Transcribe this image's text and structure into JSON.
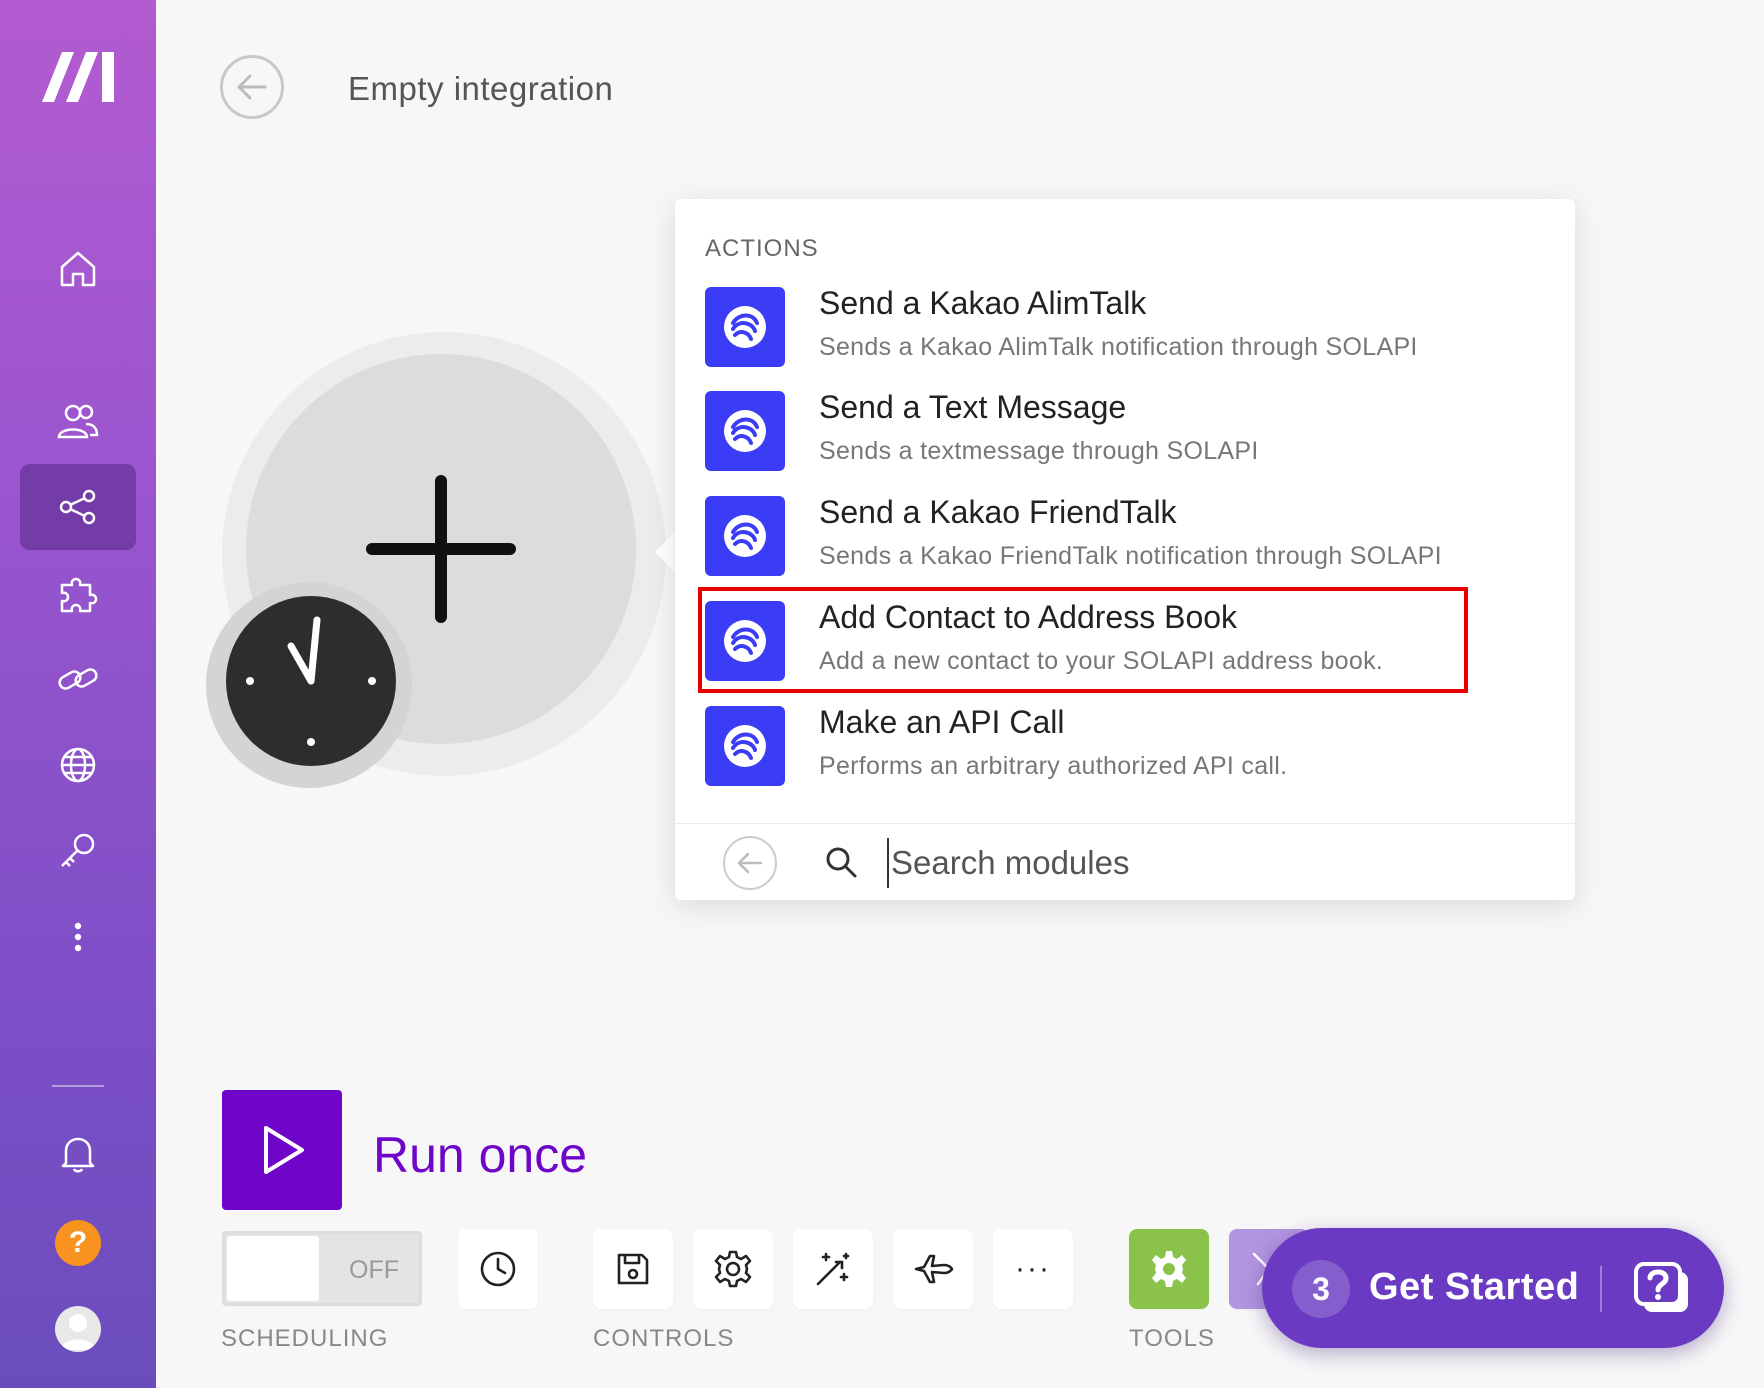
{
  "header": {
    "title": "Empty integration"
  },
  "popup": {
    "section_label": "ACTIONS",
    "actions": [
      {
        "title": "Send a Kakao AlimTalk",
        "description": "Sends a Kakao AlimTalk notification through SOLAPI"
      },
      {
        "title": "Send a Text Message",
        "description": "Sends a textmessage through SOLAPI"
      },
      {
        "title": "Send a Kakao FriendTalk",
        "description": "Sends a Kakao FriendTalk notification through SOLAPI"
      },
      {
        "title": "Add Contact to Address Book",
        "description": "Add a new contact to your SOLAPI address book."
      },
      {
        "title": "Make an API Call",
        "description": "Performs an arbitrary authorized API call."
      }
    ],
    "search_placeholder": "Search modules"
  },
  "toolbar": {
    "run_label": "Run once",
    "toggle_state": "OFF",
    "scheduling_label": "SCHEDULING",
    "controls_label": "CONTROLS",
    "tools_label": "TOOLS",
    "more_label": "···"
  },
  "get_started": {
    "count": "3",
    "label": "Get Started"
  },
  "sidebar": {
    "help_label": "?"
  },
  "colors": {
    "accent": "#6f05c9",
    "app_icon": "#3b3cf5",
    "highlight": "#e60000",
    "tools_green": "#8bc34a",
    "get_started_bg": "#6a3bc2"
  }
}
